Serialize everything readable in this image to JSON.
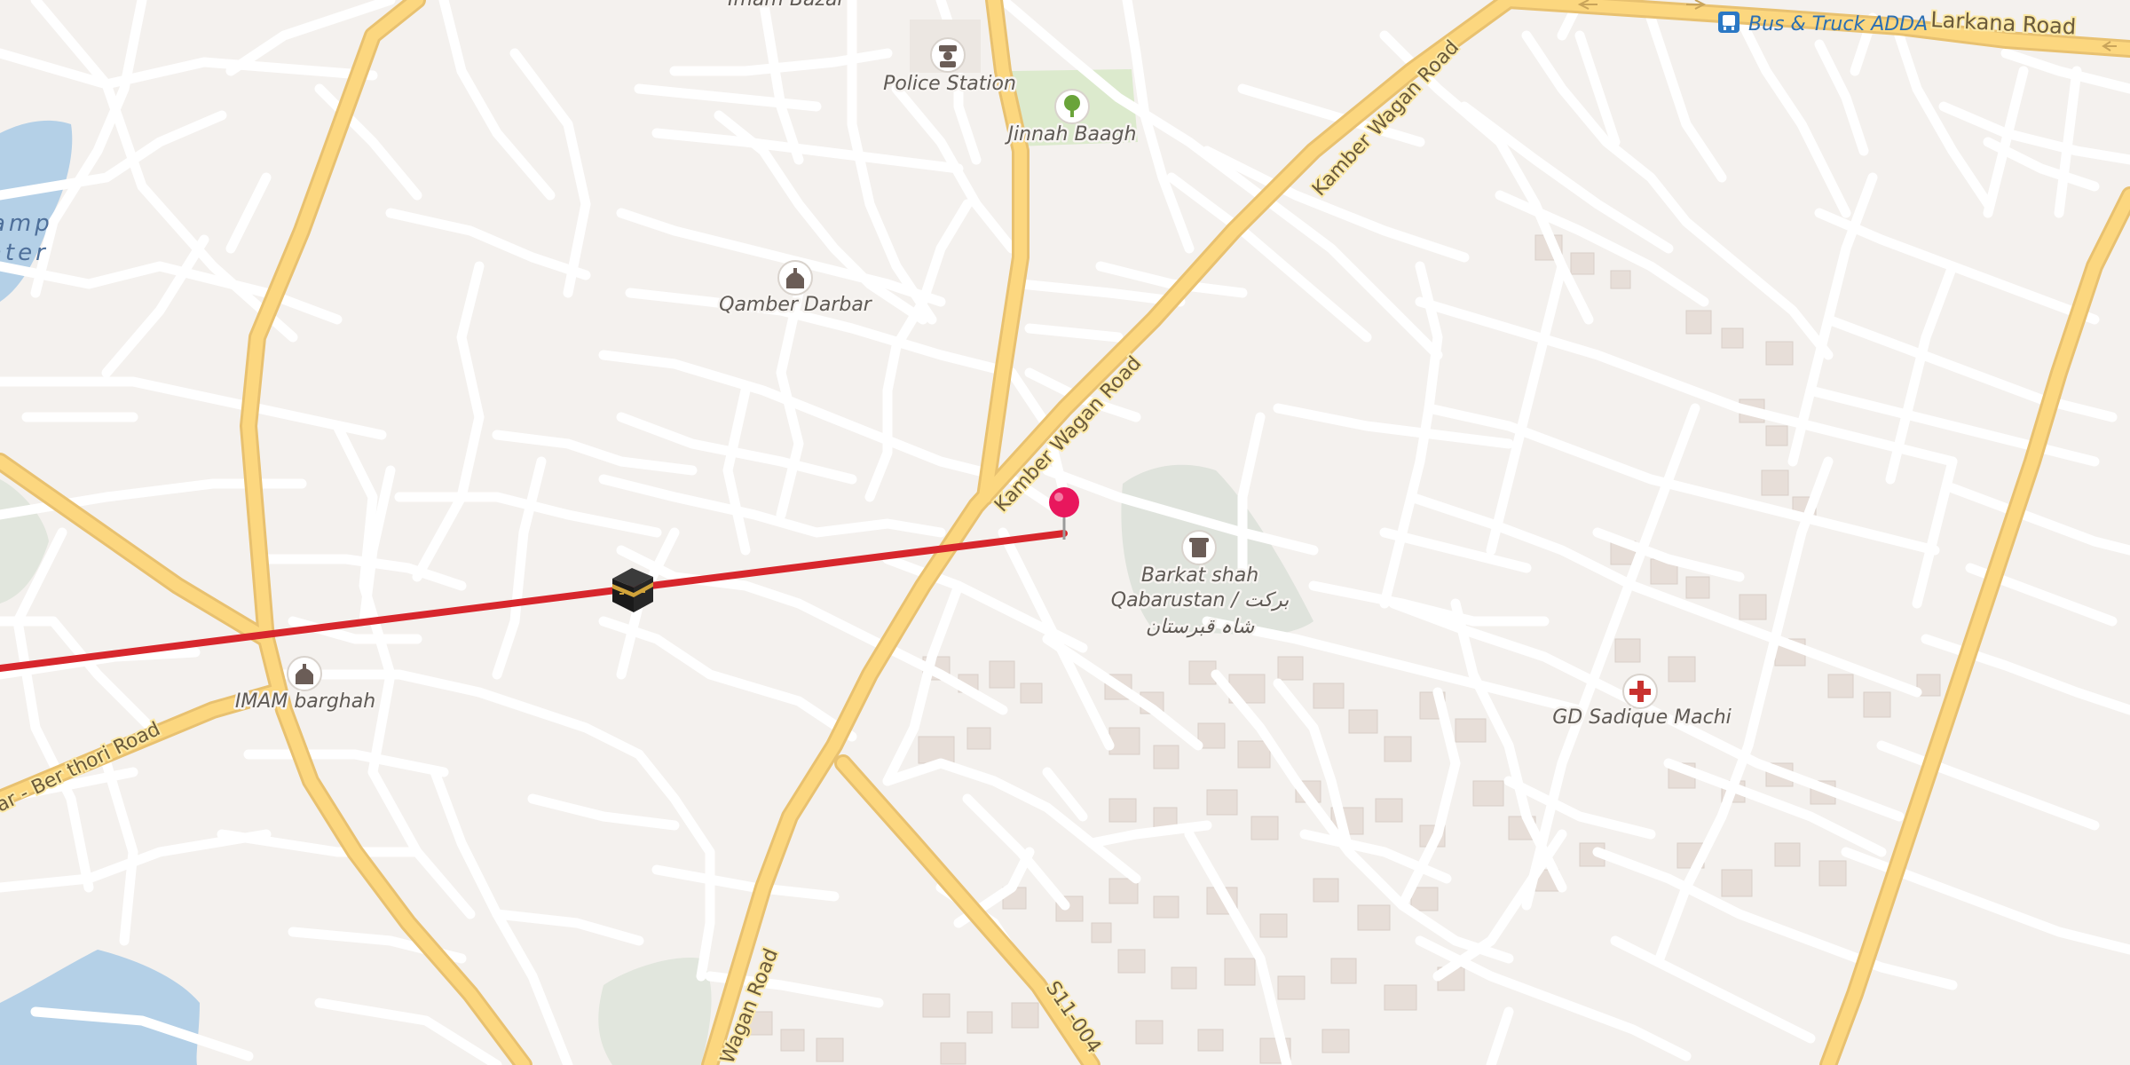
{
  "map": {
    "road_labels": {
      "kamber_wagan_north": "Kamber Wagan Road",
      "kamber_wagan_mid": "Kamber Wagan Road",
      "wagan_road_south": "Wagan Road",
      "larkana_road": "Larkana Road",
      "ber_thori_road": "ar - Ber thori Road",
      "s11_004": "S11-004"
    },
    "places": {
      "imam_bazar": "Imam Bazar",
      "police_station": "Police Station",
      "jinnah_baagh": "Jinnah Baagh",
      "qamber_darbar": "Qamber Darbar",
      "barkat_shah_line1": "Barkat shah",
      "barkat_shah_line2": "Qabarustan / برکت",
      "barkat_shah_line3": "شاہ قبرستان",
      "imam_barghah": "IMAM barghah",
      "gd_sadique_machi": "GD Sadique Machi",
      "bus_truck_adda": "Bus & Truck ADDA"
    },
    "water_labels": {
      "line1": "amp",
      "line2": "ater"
    },
    "icons": {
      "police": "police-icon",
      "park": "tree-icon",
      "mosque": "mosque-icon",
      "cemetery": "cemetery-icon",
      "hospital": "hospital-cross-icon",
      "bus": "bus-icon",
      "kaaba": "kaaba-icon",
      "pin": "location-pin-icon"
    },
    "colors": {
      "land": "#f4f1ee",
      "minor_road": "#ffffff",
      "major_road": "#fcd77f",
      "water": "#b4d0e7",
      "park": "#dceacd",
      "cemetery": "#d8ddd3",
      "route_line": "#d7262c",
      "pin": "#e8175d"
    }
  }
}
